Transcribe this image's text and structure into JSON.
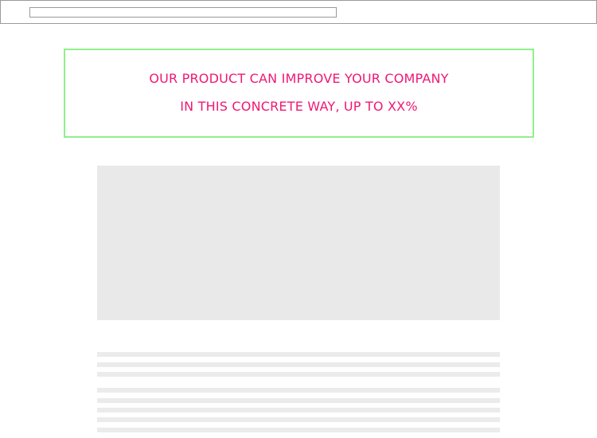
{
  "browser": {
    "address_value": ""
  },
  "headline": {
    "line1": "OUR PRODUCT CAN IMPROVE YOUR COMPANY",
    "line2": "IN THIS CONCRETE WAY, UP TO XX%"
  },
  "colors": {
    "accent_text": "#ef1874",
    "frame_green": "#8ff08a",
    "placeholder_gray": "#e9e9e9",
    "border_gray": "#9a9a9a"
  }
}
